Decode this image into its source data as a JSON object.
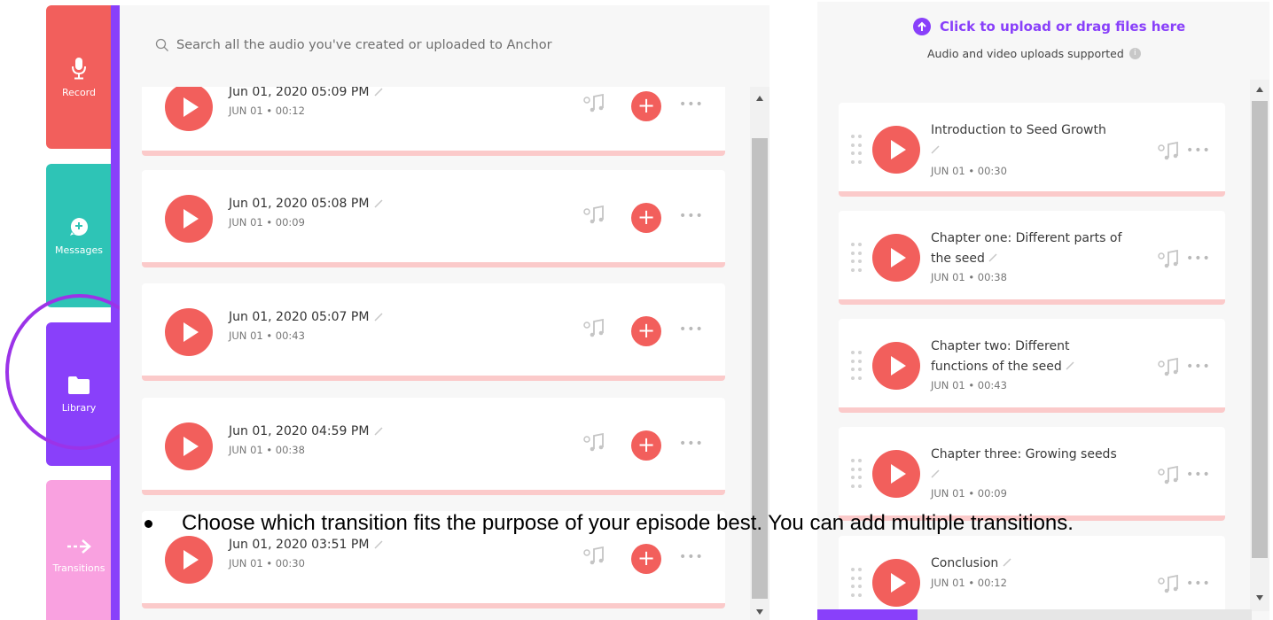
{
  "nav": {
    "record": "Record",
    "messages": "Messages",
    "library": "Library",
    "transitions": "Transitions"
  },
  "library": {
    "search_placeholder": "Search all the audio you've created or uploaded to Anchor",
    "items": [
      {
        "title": "Jun 01, 2020 05:09 PM",
        "meta": "JUN 01 • 00:12"
      },
      {
        "title": "Jun 01, 2020 05:08 PM",
        "meta": "JUN 01 • 00:09"
      },
      {
        "title": "Jun 01, 2020 05:07 PM",
        "meta": "JUN 01 • 00:43"
      },
      {
        "title": "Jun 01, 2020 04:59 PM",
        "meta": "JUN 01 • 00:38"
      },
      {
        "title": "Jun 01, 2020 03:51 PM",
        "meta": "JUN 01 • 00:30"
      }
    ]
  },
  "episode": {
    "upload_label": "Click to upload or drag files here",
    "upload_sub": "Audio and video uploads supported",
    "segments": [
      {
        "title": "Introduction to Seed Growth",
        "meta": "JUN 01 • 00:30"
      },
      {
        "title": "Chapter one: Different parts of the seed",
        "meta": "JUN 01 • 00:38"
      },
      {
        "title": "Chapter two: Different functions of the seed",
        "meta": "JUN 01 • 00:43"
      },
      {
        "title": "Chapter three: Growing seeds",
        "meta": "JUN 01 • 00:09"
      },
      {
        "title": "Conclusion",
        "meta": "JUN 01 • 00:12"
      }
    ],
    "progress": 0.23
  },
  "instruction": "Choose which transition fits the purpose of your episode best. You can add multiple transitions.",
  "colors": {
    "record": "#f25f5c",
    "messages": "#2ec4b6",
    "library": "#8940fa",
    "transitions": "#f9a1e0",
    "accent": "#8940fa",
    "play": "#f25f5c",
    "card_border": "#fbcaca"
  }
}
